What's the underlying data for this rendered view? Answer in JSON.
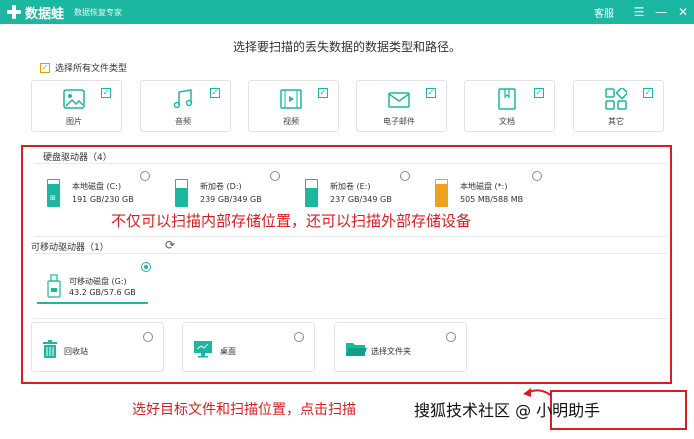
{
  "titlebar": {
    "app_name": "数据蛙",
    "subtitle": "数据恢复专家",
    "service": "客服",
    "controls": [
      "☰",
      "—",
      "✕"
    ]
  },
  "heading": "选择要扫描的丢失数据的数据类型和路径。",
  "select_all": {
    "label": "选择所有文件类型",
    "checked": true
  },
  "file_types": [
    {
      "label": "图片",
      "checked": true,
      "icon": "image-icon"
    },
    {
      "label": "音频",
      "checked": true,
      "icon": "music-icon"
    },
    {
      "label": "视频",
      "checked": true,
      "icon": "video-icon"
    },
    {
      "label": "电子邮件",
      "checked": true,
      "icon": "email-icon"
    },
    {
      "label": "文档",
      "checked": true,
      "icon": "document-icon"
    },
    {
      "label": "其它",
      "checked": true,
      "icon": "other-icon"
    }
  ],
  "hdd_section": {
    "label": "硬盘驱动器（4）",
    "drives": [
      {
        "name": "本地磁盘 (C:)",
        "size": "191 GB/230 GB",
        "used_fraction": 0.83,
        "color": "#1bb7a0",
        "windows": true
      },
      {
        "name": "新加卷 (D:)",
        "size": "239 GB/349 GB",
        "used_fraction": 0.68,
        "color": "#1bb7a0",
        "windows": false
      },
      {
        "name": "新加卷 (E:)",
        "size": "237 GB/349 GB",
        "used_fraction": 0.68,
        "color": "#1bb7a0",
        "windows": false
      },
      {
        "name": "本地磁盘 (*:)",
        "size": "505 MB/588 MB",
        "used_fraction": 0.86,
        "color": "#f0a020",
        "windows": false
      }
    ]
  },
  "overlay_caption": "不仅可以扫描内部存储位置，还可以扫描外部存储设备",
  "removable_section": {
    "label": "可移动驱动器（1）",
    "drives": [
      {
        "name": "可移动磁盘 (G:)",
        "size": "43.2 GB/57.6 GB",
        "selected": true
      }
    ]
  },
  "locations": [
    {
      "label": "回收站",
      "icon": "recycle-bin-icon"
    },
    {
      "label": "桌面",
      "icon": "desktop-icon"
    },
    {
      "label": "选择文件夹",
      "icon": "folder-icon"
    }
  ],
  "bottom_caption": "选好目标文件和扫描位置，点击扫描",
  "watermark": "搜狐技术社区 @ 小明助手",
  "colors": {
    "brand": "#1bb7a0",
    "annotation": "#d81e1e",
    "warning": "#f0a020"
  }
}
